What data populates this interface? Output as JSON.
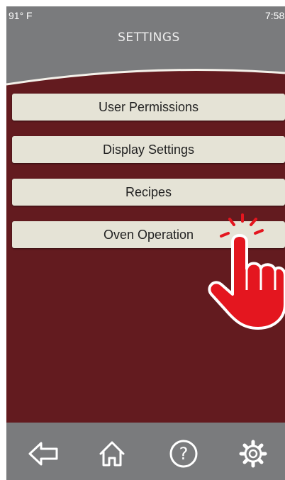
{
  "status": {
    "temperature": "91° F",
    "time": "7:58"
  },
  "header": {
    "title": "SETTINGS"
  },
  "menu": {
    "items": [
      {
        "label": "User Permissions"
      },
      {
        "label": "Display Settings"
      },
      {
        "label": "Recipes"
      },
      {
        "label": "Oven Operation"
      }
    ]
  },
  "nav": {
    "back_icon": "back-arrow-icon",
    "home_icon": "home-icon",
    "help_icon": "help-icon",
    "settings_icon": "gear-icon"
  },
  "colors": {
    "panel": "#631b1f",
    "chrome": "#7a7b7d",
    "button": "#e5e3d6",
    "pointer": "#e4161f"
  }
}
